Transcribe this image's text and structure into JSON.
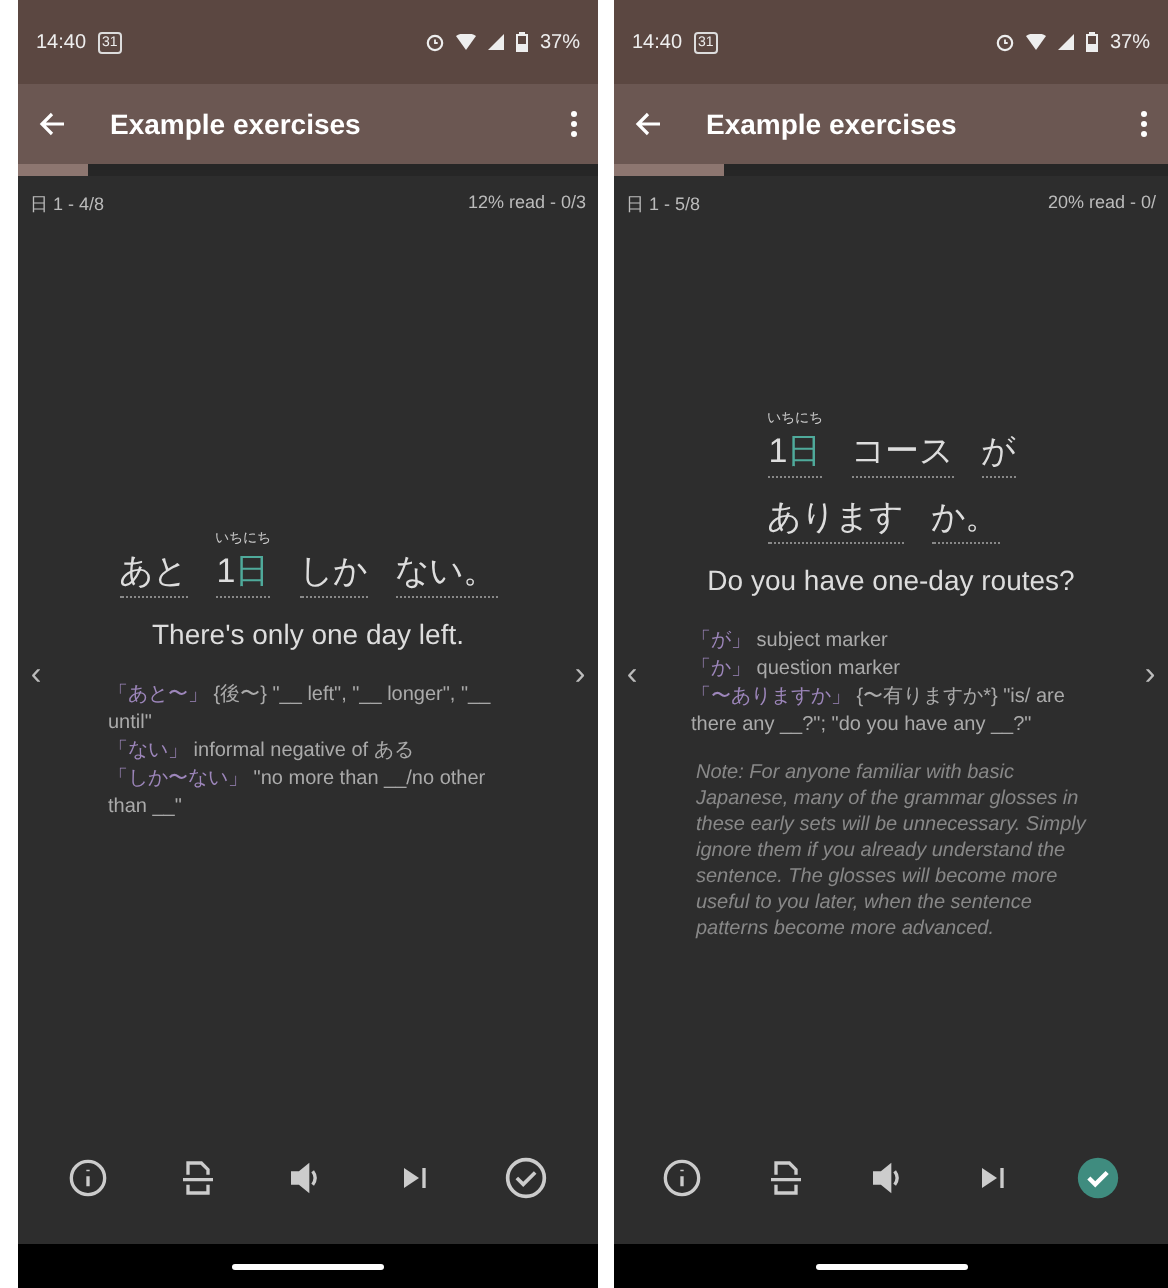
{
  "screens": [
    {
      "status_bar": {
        "time": "14:40",
        "calendar": "31",
        "battery": "37%"
      },
      "title": "Example exercises",
      "progress": {
        "level": 0.12
      },
      "set_label": "日 1 - 4/8",
      "read_label": "12% read - 0/3",
      "sentence": [
        [
          {
            "parts": [
              {
                "text": "あと",
                "highlight": false
              }
            ]
          },
          {
            "ruby": "いちにち",
            "parts": [
              {
                "text": "1",
                "highlight": false
              },
              {
                "text": "日",
                "highlight": true
              }
            ]
          },
          {
            "parts": [
              {
                "text": "しか",
                "highlight": false
              }
            ]
          },
          {
            "parts": [
              {
                "text": "ない。",
                "highlight": false
              }
            ]
          }
        ]
      ],
      "translation": "There's only one day left.",
      "chevrons": {
        "previous": "‹",
        "next": "›"
      },
      "glosses": [
        {
          "term": "「あと〜」",
          "text": "{後〜} \"__ left\", \"__ longer\", \"__ until\""
        },
        {
          "term": "「ない」",
          "text": "informal negative of ある"
        },
        {
          "term": "「しか〜ない」",
          "text": "\"no more than __/no other than __\""
        }
      ],
      "done": false
    },
    {
      "status_bar": {
        "time": "14:40",
        "calendar": "31",
        "battery": "37%"
      },
      "title": "Example exercises",
      "progress": {
        "level": 0.2
      },
      "set_label": "日 1 - 5/8",
      "read_label": "20% read - 0/",
      "sentence": [
        [
          {
            "ruby": "いちにち",
            "parts": [
              {
                "text": "1",
                "highlight": false
              },
              {
                "text": "日",
                "highlight": true
              }
            ]
          },
          {
            "parts": [
              {
                "text": "コース",
                "highlight": false
              }
            ]
          },
          {
            "parts": [
              {
                "text": "が",
                "highlight": false
              }
            ]
          }
        ],
        [
          {
            "parts": [
              {
                "text": "あります",
                "highlight": false
              }
            ]
          },
          {
            "parts": [
              {
                "text": "か。",
                "highlight": false
              }
            ]
          }
        ]
      ],
      "translation": "Do you have one-day routes?",
      "chevrons": {
        "previous": "‹",
        "next": "›"
      },
      "glosses": [
        {
          "term": "「が」",
          "text": "subject marker"
        },
        {
          "term": "「か」",
          "text": "question marker"
        },
        {
          "term": "「〜ありますか」",
          "text": "{〜有りますか*} \"is/ are there any __?\"; \"do you have any __?\""
        }
      ],
      "note": "Note: For anyone familiar with basic Japanese, many of the grammar glosses in these early sets will be unnecessary. Simply ignore them if you already understand the sentence. The glosses will become more useful to you later, when the sentence patterns become more advanced.",
      "done": true
    }
  ]
}
